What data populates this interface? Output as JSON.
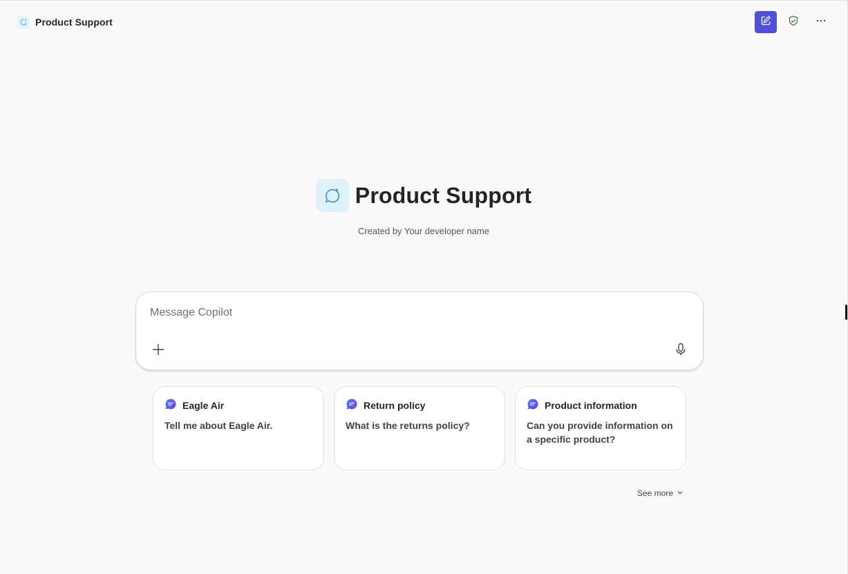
{
  "header": {
    "title": "Product Support",
    "new_chat_icon": "compose-icon",
    "shield_icon": "shield-check-icon",
    "more_icon": "more-horizontal-icon"
  },
  "hero": {
    "title": "Product Support",
    "subtitle": "Created by Your developer name"
  },
  "composer": {
    "placeholder": "Message Copilot",
    "value": "",
    "add_icon": "plus-icon",
    "mic_icon": "microphone-icon"
  },
  "suggestions": [
    {
      "title": "Eagle Air",
      "prompt": "Tell me about Eagle Air."
    },
    {
      "title": "Return policy",
      "prompt": "What is the returns policy?"
    },
    {
      "title": "Product information",
      "prompt": "Can you provide information on a specific product?"
    }
  ],
  "see_more": {
    "label": "See more"
  },
  "colors": {
    "accent": "#4f52d9",
    "background": "#fcf9fb",
    "shield": "#2e7d32",
    "logo_bg": "#ddf1fb"
  }
}
